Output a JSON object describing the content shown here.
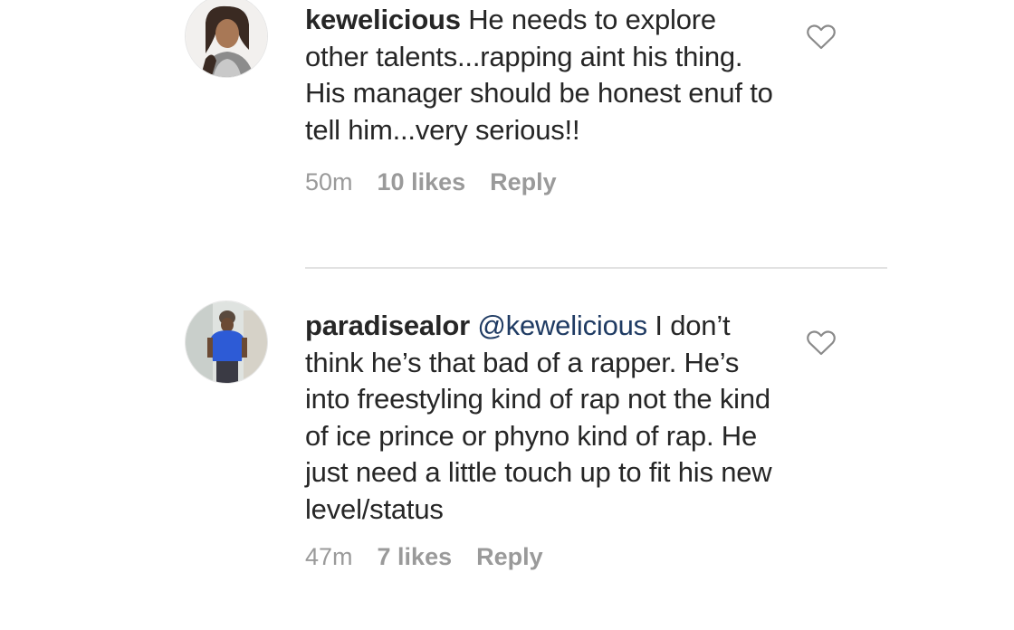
{
  "comments": [
    {
      "username": "kewelicious",
      "mention": "",
      "text": " He needs to explore other talents...rapping aint his thing. His manager should be honest enuf to tell him...very serious!!",
      "time": "50m",
      "likes": "10 likes",
      "reply": "Reply",
      "like_icon": "heart-outline-icon"
    },
    {
      "username": "paradisealor",
      "mention": " @kewelicious",
      "text": " I don’t think he’s that bad of a rapper. He’s into freestyling kind of rap not the kind of ice prince or phyno kind of rap. He just need a little touch up to fit his new level/status",
      "time": "47m",
      "likes": "7 likes",
      "reply": "Reply",
      "like_icon": "heart-outline-icon"
    }
  ],
  "colors": {
    "text": "#262626",
    "meta": "#9a9a9a",
    "mention": "#1f3b63",
    "divider": "#e2e2e2"
  }
}
